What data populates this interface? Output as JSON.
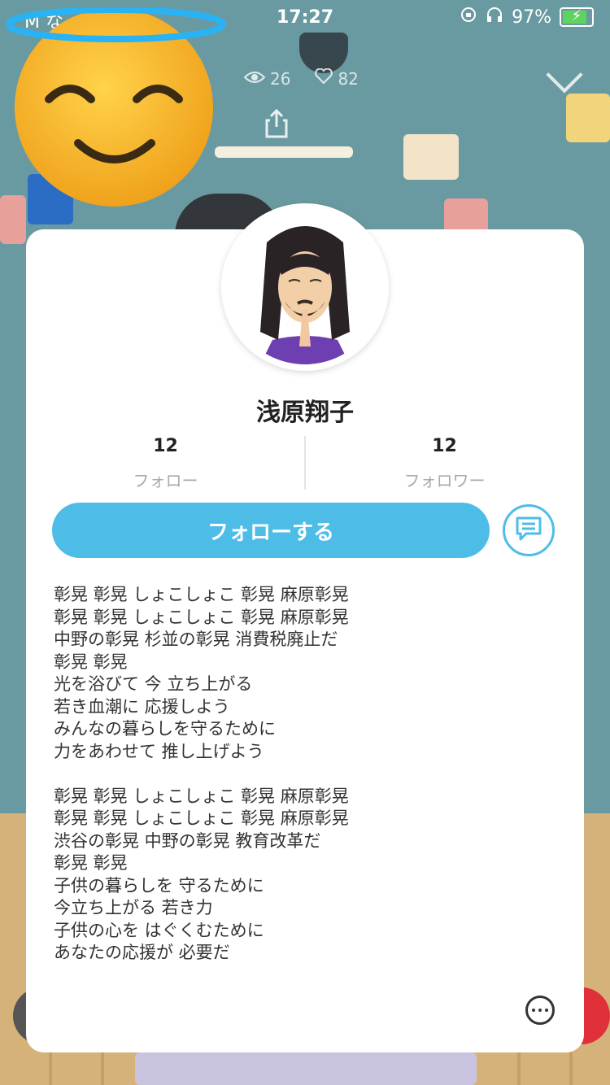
{
  "status_bar": {
    "carrier": "M な",
    "time": "17:27",
    "battery_percent": "97%",
    "battery_level": 0.97
  },
  "live": {
    "views": "26",
    "likes": "82"
  },
  "profile": {
    "name": "浅原翔子",
    "following_count": "12",
    "following_label": "フォロー",
    "followers_count": "12",
    "followers_label": "フォロワー",
    "follow_button_label": "フォローする",
    "bio": "彰晃 彰晃 しょこしょこ 彰晃 麻原彰晃\n彰晃 彰晃 しょこしょこ 彰晃 麻原彰晃\n中野の彰晃 杉並の彰晃 消費税廃止だ\n彰晃 彰晃\n光を浴びて 今 立ち上がる\n若き血潮に 応援しよう\nみんなの暮らしを守るために\n力をあわせて 推し上げよう\n\n彰晃 彰晃 しょこしょこ 彰晃 麻原彰晃\n彰晃 彰晃 しょこしょこ 彰晃 麻原彰晃\n渋谷の彰晃 中野の彰晃 教育改革だ\n彰晃 彰晃\n子供の暮らしを 守るために\n今立ち上がる 若き力\n子供の心を はぐくむために\nあなたの応援が 必要だ"
  },
  "colors": {
    "accent": "#4dbde8",
    "card_bg": "#ffffff",
    "text_primary": "#222222",
    "text_secondary": "#aaaaaa"
  },
  "icons": {
    "views": "eye-icon",
    "likes": "heart-icon",
    "share": "share-icon",
    "close": "chevron-down-icon",
    "message": "message-icon",
    "more": "more-icon"
  }
}
